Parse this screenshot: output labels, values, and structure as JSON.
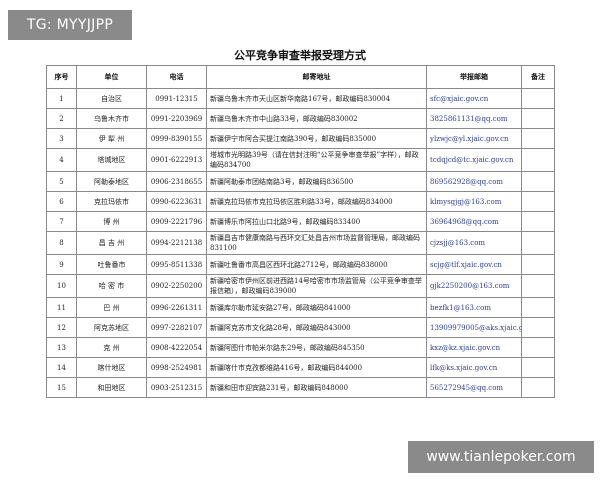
{
  "tag": "TG: MYYJJPP",
  "title": "公平竞争审查举报受理方式",
  "headers": {
    "no": "序号",
    "unit": "单位",
    "phone": "电话",
    "addr": "邮寄地址",
    "email": "举报邮箱",
    "note": "备注"
  },
  "rows": [
    {
      "no": "1",
      "unit": "自治区",
      "phone": "0991-12315",
      "addr": "新疆乌鲁木齐市天山区新华南路167号，邮政编码830004",
      "email": "sfc@xjaic.gov.cn",
      "note": ""
    },
    {
      "no": "2",
      "unit": "乌鲁木齐市",
      "phone": "0991-2203969",
      "addr": "新疆乌鲁木齐市中山路33号，邮政编码830002",
      "email": "3825861131@qq.com",
      "note": ""
    },
    {
      "no": "3",
      "unit": "伊 犁 州",
      "phone": "0999-8390155",
      "addr": "新疆伊宁市阿合买提江南路390号，邮政编码835000",
      "email": "ylzwjc@yl.xjaic.gov.cn",
      "note": ""
    },
    {
      "no": "4",
      "unit": "塔城地区",
      "phone": "0901-6222913",
      "addr": "塔城市光明路39号（请在信封注明“公平竞争审查举报”字样），邮政编码834700",
      "email": "tcdqjcd@tc.xjaic.gov.cn",
      "note": ""
    },
    {
      "no": "5",
      "unit": "阿勒泰地区",
      "phone": "0906-2318655",
      "addr": "新疆阿勒泰市团结南路3号，邮政编码836500",
      "email": "869562928@qq.com",
      "note": ""
    },
    {
      "no": "6",
      "unit": "克拉玛依市",
      "phone": "0990-6223631",
      "addr": "新疆克拉玛依市克拉玛依区胜利路33号，邮政编码834000",
      "email": "klmysgjgj@163.com",
      "note": ""
    },
    {
      "no": "7",
      "unit": "博 州",
      "phone": "0909-2221796",
      "addr": "新疆博乐市阿拉山口北路9号，邮政编码833400",
      "email": "36964968@qq.com",
      "note": ""
    },
    {
      "no": "8",
      "unit": "昌 吉 州",
      "phone": "0994-2212138",
      "addr": "新疆昌吉市健康南路与西环交汇处昌吉州市场监督管理局，邮政编码831100",
      "email": "cjzsjj@163.com",
      "note": ""
    },
    {
      "no": "9",
      "unit": "吐鲁番市",
      "phone": "0995-8511338",
      "addr": "新疆吐鲁番市高昌区西环北路2712号，邮政编码838000",
      "email": "scjg@tlf.xjaic.gov.cn",
      "note": ""
    },
    {
      "no": "10",
      "unit": "哈 密 市",
      "phone": "0902-2250200",
      "addr": "新疆哈密市伊州区前进西路14号哈密市市场监管局（公平竞争审查举报信箱），邮政编码839000",
      "email": "gjk2250200@163.com",
      "note": ""
    },
    {
      "no": "11",
      "unit": "巴 州",
      "phone": "0996-2261311",
      "addr": "新疆库尔勒市延安路27号，邮政编码841000",
      "email": "bezfk1@163.com",
      "note": ""
    },
    {
      "no": "12",
      "unit": "阿克苏地区",
      "phone": "0997-2282107",
      "addr": "新疆阿克苏市文化路28号，邮政编码843000",
      "email": "13909979005@aks.xjaic.gov.cn",
      "note": ""
    },
    {
      "no": "13",
      "unit": "克 州",
      "phone": "0908-4222054",
      "addr": "新疆阿图什市帕米尔路东29号，邮政编码845350",
      "email": "kxz@kz.xjaic.gov.cn",
      "note": ""
    },
    {
      "no": "14",
      "unit": "喀什地区",
      "phone": "0998-2524981",
      "addr": "新疆喀什市克孜都维路416号，邮政编码844000",
      "email": "lfk@ks.xjaic.gov.cn",
      "note": ""
    },
    {
      "no": "15",
      "unit": "和田地区",
      "phone": "0903-2512315",
      "addr": "新疆和田市迎宾路231号，邮政编码848000",
      "email": "565272945@qq.com",
      "note": ""
    }
  ],
  "watermark": "www.tianlepoker.com"
}
